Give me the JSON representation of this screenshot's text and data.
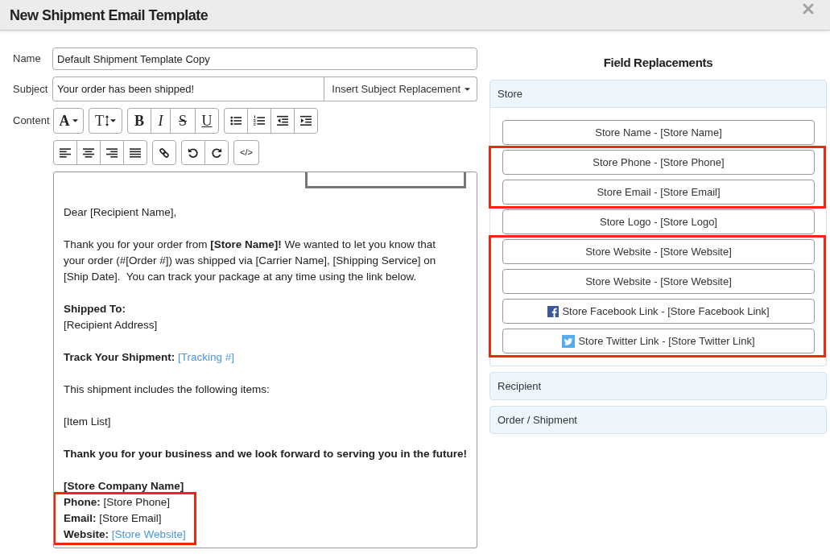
{
  "window": {
    "title": "New Shipment Email Template"
  },
  "form": {
    "name": {
      "label": "Name",
      "value": "Default Shipment Template Copy"
    },
    "subject": {
      "label": "Subject",
      "value": "Your order has been shipped!",
      "menu_button": "Insert Subject Replacement"
    },
    "content_label": "Content"
  },
  "toolbar": [
    [
      [
        {
          "kind": "font-color",
          "label": "A"
        }
      ],
      [
        {
          "kind": "font-size",
          "label": "T"
        }
      ],
      [
        {
          "kind": "bold",
          "label": "B"
        },
        {
          "kind": "italic",
          "label": "I"
        },
        {
          "kind": "strikethrough",
          "label": "S"
        },
        {
          "kind": "underline",
          "label": "U"
        }
      ],
      [
        {
          "kind": "bullet-list"
        },
        {
          "kind": "numbered-list"
        },
        {
          "kind": "outdent"
        },
        {
          "kind": "indent"
        }
      ]
    ],
    [
      [
        {
          "kind": "align-left"
        },
        {
          "kind": "align-center"
        },
        {
          "kind": "align-right"
        },
        {
          "kind": "justify"
        }
      ],
      [
        {
          "kind": "link"
        }
      ],
      [
        {
          "kind": "undo"
        },
        {
          "kind": "redo"
        }
      ],
      [
        {
          "kind": "code",
          "label": "</>"
        }
      ]
    ]
  ],
  "editor": {
    "blocks": [
      {
        "kind": "paragraph",
        "lines": [
          {
            "text": "Dear [Recipient Name],"
          }
        ]
      },
      {
        "kind": "paragraph",
        "lines": [
          {
            "text": "Thank you for your order from **[Store Name]!** We wanted to let you know that"
          },
          {
            "text": "your order (#[Order #]) was shipped via [Carrier Name], [Shipping Service] on"
          },
          {
            "text": "[Ship Date].  You can track your package at any time using the link below."
          }
        ]
      },
      {
        "kind": "paragraph",
        "lines": [
          {
            "text": "Shipped To:",
            "bold": true
          },
          {
            "text": "[Recipient Address]"
          }
        ]
      },
      {
        "kind": "paragraph",
        "lines": [
          {
            "text": "**Track Your Shipment:**",
            "link": "[Tracking #]"
          }
        ]
      },
      {
        "kind": "paragraph",
        "lines": [
          {
            "text": "This shipment includes the following items:"
          }
        ]
      },
      {
        "kind": "paragraph",
        "lines": [
          {
            "text": "[Item List]"
          }
        ]
      },
      {
        "kind": "paragraph",
        "lines": [
          {
            "text": "Thank you for your business and we look forward to serving you in the future!",
            "bold": true
          }
        ]
      },
      {
        "kind": "contact",
        "lines": [
          {
            "text": "[Store Company Name]",
            "bold": true,
            "highlighted": false
          },
          {
            "text": "**Phone:** [Store Phone]",
            "highlighted": true
          },
          {
            "text": "**Email:** [Store Email]",
            "highlighted": true
          },
          {
            "text": "**Website:**",
            "link": "[Store Website]",
            "highlighted": true
          }
        ]
      }
    ]
  },
  "field_replacements": {
    "title": "Field Replacements",
    "sections": [
      {
        "title": "Store",
        "expanded": true,
        "buttons": [
          {
            "label": "Store Name - [Store Name]",
            "kind": "plain",
            "highlighted": false
          },
          {
            "label": "Store Phone - [Store Phone]",
            "kind": "plain",
            "highlighted": true
          },
          {
            "label": "Store Email - [Store Email]",
            "kind": "plain",
            "highlighted": true
          },
          {
            "label": "Store Logo - [Store Logo]",
            "kind": "plain",
            "highlighted": false
          },
          {
            "label": "Store Website - [Store Website]",
            "kind": "plain",
            "highlighted": true
          },
          {
            "label": "Store Website - [Store Website]",
            "kind": "plain",
            "highlighted": true
          },
          {
            "label": "Store Facebook Link - [Store Facebook Link]",
            "kind": "facebook",
            "highlighted": true
          },
          {
            "label": "Store Twitter Link - [Store Twitter Link]",
            "kind": "twitter",
            "highlighted": true
          }
        ]
      },
      {
        "title": "Recipient",
        "expanded": false
      },
      {
        "title": "Order / Shipment",
        "expanded": false
      }
    ]
  }
}
